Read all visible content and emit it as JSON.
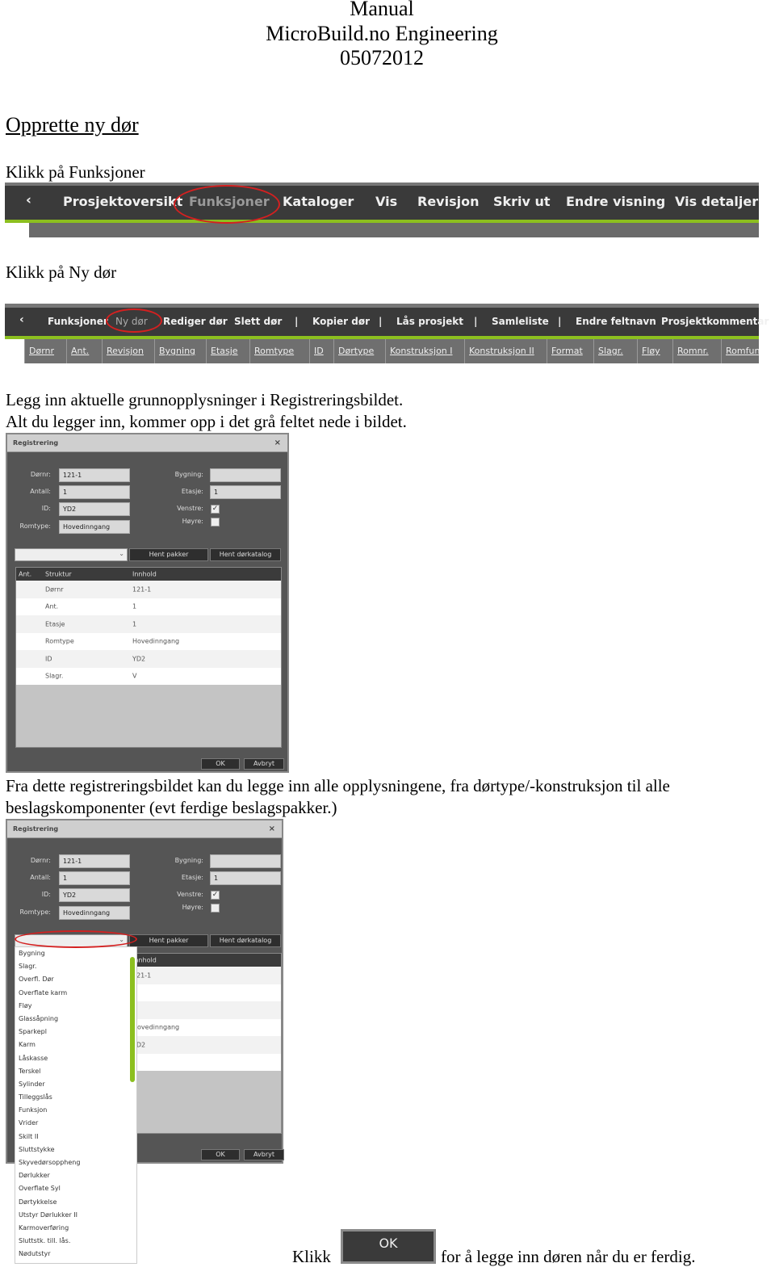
{
  "header": {
    "line1": "Manual",
    "line2": "MicroBuild.no Engineering",
    "line3": "05072012"
  },
  "section_title": "Opprette ny dør",
  "step1": "Klikk på Funksjoner",
  "menu1": {
    "back_icon": "chevron-left-icon",
    "items": [
      "Prosjektoversikt",
      "Funksjoner",
      "Kataloger",
      "Vis",
      "Revisjon",
      "Skriv ut",
      "Endre visning",
      "Vis detaljer"
    ],
    "highlight": "Funksjoner",
    "accent": "#8cbf1f",
    "circle_color": "#d42020"
  },
  "step2": "Klikk på Ny dør",
  "menu2": {
    "items": [
      "Funksjoner",
      "Ny dør",
      "Rediger dør",
      "Slett dør",
      "|",
      "Kopier dør",
      "|",
      "Lås prosjekt",
      "|",
      "Samleliste",
      "|",
      "Endre feltnavn",
      "Prosjektkommentar"
    ],
    "highlight": "Ny dør",
    "columns": [
      "Dørnr",
      "Ant.",
      "Revisjon",
      "Bygning",
      "Etasje",
      "Romtype",
      "ID",
      "Dørtype",
      "Konstruksjon I",
      "Konstruksjon II",
      "Format",
      "Slagr.",
      "Fløy",
      "Romnr.",
      "Romfun"
    ]
  },
  "para1": {
    "line1": "Legg inn aktuelle grunnopplysninger i Registreringsbildet.",
    "line2": "Alt du legger inn, kommer opp i det grå feltet nede i bildet."
  },
  "dialog": {
    "title": "Registrering",
    "close": "×",
    "fields": {
      "dornr_label": "Dørnr:",
      "dornr": "121-1",
      "antall_label": "Antall:",
      "antall": "1",
      "id_label": "ID:",
      "id": "YD2",
      "romtype_label": "Romtype:",
      "romtype": "Hovedinngang",
      "bygning_label": "Bygning:",
      "bygning": "",
      "etasje_label": "Etasje:",
      "etasje": "1",
      "venstre_label": "Venstre:",
      "venstre_checked": "✓",
      "hoyre_label": "Høyre:"
    },
    "hent_pakker": "Hent pakker",
    "hent_dorkatalog": "Hent dørkatalog",
    "table_headers": [
      "Ant.",
      "Struktur",
      "Innhold"
    ],
    "rows": [
      [
        "Dørnr",
        "121-1"
      ],
      [
        "Ant.",
        "1"
      ],
      [
        "Etasje",
        "1"
      ],
      [
        "Romtype",
        "Hovedinngang"
      ],
      [
        "ID",
        "YD2"
      ],
      [
        "Slagr.",
        "V"
      ]
    ],
    "ok": "OK",
    "avbryt": "Avbryt"
  },
  "para2": {
    "line1": "Fra dette registreringsbildet kan du legge inn alle opplysningene, fra dørtype/-konstruksjon til alle",
    "line2": "beslagskomponenter (evt ferdige beslagspakker.)"
  },
  "dropdown_items": [
    "Bygning",
    "Slagr.",
    "Overfl. Dør",
    "Overflate karm",
    "Fløy",
    "Glassåpning",
    "Sparkepl",
    "Karm",
    "Låskasse",
    "Terskel",
    "Sylinder",
    "Tilleggslås",
    "Funksjon",
    "Vrider",
    "Skilt II",
    "Sluttstykke",
    "Skyvedørsoppheng",
    "Dørlukker",
    "Overflate Syl",
    "Dørtykkelse",
    "Utstyr Dørlukker II",
    "Karmoverføring",
    "Sluttstk. till. lås.",
    "Nødutstyr"
  ],
  "final": {
    "klikk": "Klikk",
    "ok": "OK",
    "rest": "for å legge inn døren når du er ferdig."
  }
}
